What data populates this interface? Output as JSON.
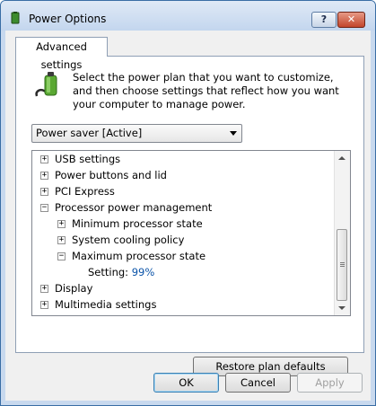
{
  "window": {
    "title": "Power Options",
    "help_label": "?",
    "close_label": "✕"
  },
  "tab": {
    "label": "Advanced settings"
  },
  "description": "Select the power plan that you want to customize, and then choose settings that reflect how you want your computer to manage power.",
  "plan_select": {
    "value": "Power saver [Active]"
  },
  "tree": {
    "items": [
      {
        "label": "USB settings",
        "expander": "+"
      },
      {
        "label": "Power buttons and lid",
        "expander": "+"
      },
      {
        "label": "PCI Express",
        "expander": "+"
      },
      {
        "label": "Processor power management",
        "expander": "−"
      },
      {
        "label": "Minimum processor state",
        "expander": "+"
      },
      {
        "label": "System cooling policy",
        "expander": "+"
      },
      {
        "label": "Maximum processor state",
        "expander": "−"
      },
      {
        "label": "Display",
        "expander": "+"
      },
      {
        "label": "Multimedia settings",
        "expander": "+"
      }
    ],
    "setting": {
      "label": "Setting:",
      "value": "99%"
    }
  },
  "buttons": {
    "restore": "Restore plan defaults",
    "ok": "OK",
    "cancel": "Cancel",
    "apply": "Apply"
  },
  "colors": {
    "accent": "#0a53a8",
    "close": "#c2452b",
    "battery": "#5aa832"
  }
}
